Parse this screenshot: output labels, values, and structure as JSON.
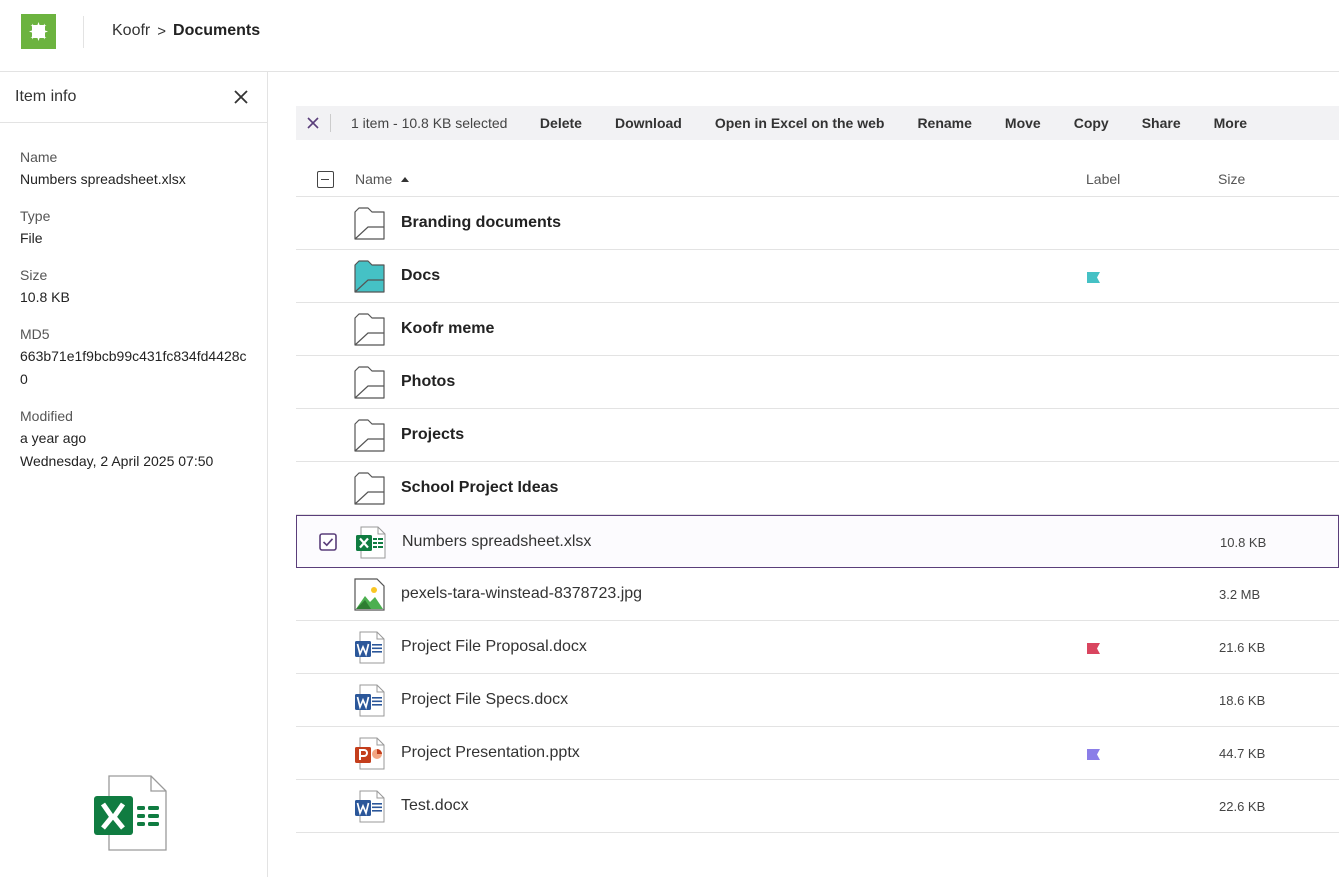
{
  "breadcrumb": {
    "home": "Koofr",
    "separator": ">",
    "current": "Documents"
  },
  "sidebar": {
    "title": "Item info",
    "fields": [
      {
        "label": "Name",
        "values": [
          "Numbers spreadsheet.xlsx"
        ]
      },
      {
        "label": "Type",
        "values": [
          "File"
        ]
      },
      {
        "label": "Size",
        "values": [
          "10.8 KB"
        ]
      },
      {
        "label": "MD5",
        "values": [
          "663b71e1f9bcb99c431fc834fd4428c0"
        ]
      },
      {
        "label": "Modified",
        "values": [
          "a year ago",
          "Wednesday, 2 April 2025 07:50"
        ]
      }
    ]
  },
  "selection_bar": {
    "count_text": "1 item - 10.8 KB selected",
    "actions": [
      "Delete",
      "Download",
      "Open in Excel on the web",
      "Rename",
      "Move",
      "Copy",
      "Share",
      "More"
    ]
  },
  "table": {
    "headers": {
      "name": "Name",
      "label": "Label",
      "size": "Size"
    },
    "rows": [
      {
        "name": "Branding documents",
        "kind": "folder",
        "icon": "folder-icon",
        "label": "",
        "size": ""
      },
      {
        "name": "Docs",
        "kind": "folder-teal",
        "icon": "shared-folder-icon",
        "label": "#45c1c5",
        "size": ""
      },
      {
        "name": "Koofr meme",
        "kind": "folder",
        "icon": "folder-icon",
        "label": "",
        "size": ""
      },
      {
        "name": "Photos",
        "kind": "folder",
        "icon": "folder-icon",
        "label": "",
        "size": ""
      },
      {
        "name": "Projects",
        "kind": "folder",
        "icon": "folder-icon",
        "label": "",
        "size": ""
      },
      {
        "name": "School Project Ideas",
        "kind": "folder",
        "icon": "folder-icon",
        "label": "",
        "size": ""
      },
      {
        "name": "Numbers spreadsheet.xlsx",
        "kind": "xlsx",
        "icon": "excel-file-icon",
        "label": "",
        "size": "10.8 KB",
        "selected": true
      },
      {
        "name": "pexels-tara-winstead-8378723.jpg",
        "kind": "jpg",
        "icon": "image-file-icon",
        "label": "",
        "size": "3.2 MB"
      },
      {
        "name": "Project File Proposal.docx",
        "kind": "docx",
        "icon": "word-file-icon",
        "label": "#d9455f",
        "size": "21.6 KB"
      },
      {
        "name": "Project File Specs.docx",
        "kind": "docx",
        "icon": "word-file-icon",
        "label": "",
        "size": "18.6 KB"
      },
      {
        "name": "Project Presentation.pptx",
        "kind": "pptx",
        "icon": "powerpoint-file-icon",
        "label": "#8b7ee8",
        "size": "44.7 KB"
      },
      {
        "name": "Test.docx",
        "kind": "docx",
        "icon": "word-file-icon",
        "label": "",
        "size": "22.6 KB"
      }
    ]
  },
  "colors": {
    "brand_green": "#6cb33f",
    "selected_border": "#5a3e7a",
    "excel_green": "#107c41",
    "word_blue": "#2b579a",
    "ppt_red": "#c43e1c"
  }
}
